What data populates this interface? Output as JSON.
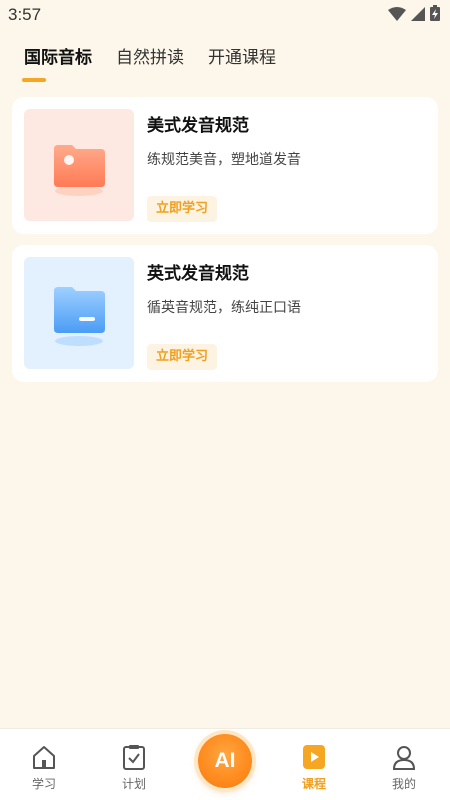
{
  "status_bar": {
    "time": "3:57"
  },
  "tabs": [
    {
      "label": "国际音标"
    },
    {
      "label": "自然拼读"
    },
    {
      "label": "开通课程"
    }
  ],
  "courses": [
    {
      "title": "美式发音规范",
      "description": "练规范美音，塑地道发音",
      "button": "立即学习"
    },
    {
      "title": "英式发音规范",
      "description": "循英音规范，练纯正口语",
      "button": "立即学习"
    }
  ],
  "bottom_nav": {
    "items": [
      {
        "label": "学习"
      },
      {
        "label": "计划"
      },
      {
        "label": "AI"
      },
      {
        "label": "课程"
      },
      {
        "label": "我的"
      }
    ]
  },
  "colors": {
    "accent": "#f5a623",
    "background": "#fdf6ea"
  }
}
